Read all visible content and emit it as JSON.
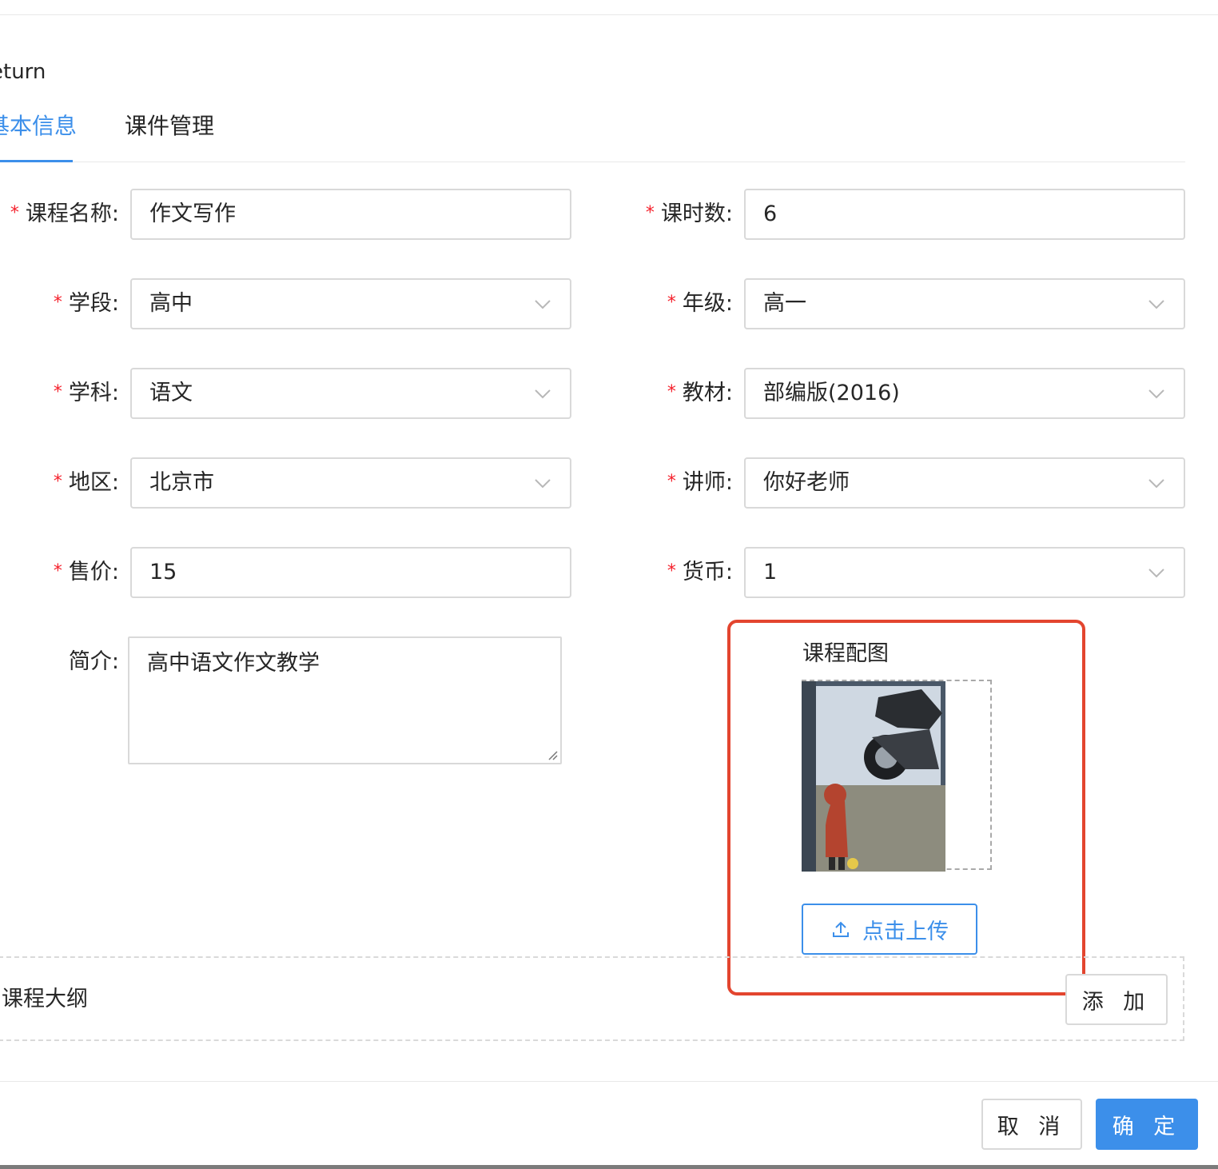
{
  "header": {
    "return_label": "eturn"
  },
  "tabs": [
    {
      "label": "基本信息",
      "active": true
    },
    {
      "label": "课件管理",
      "active": false
    }
  ],
  "required_mark": "*",
  "form": {
    "course_name": {
      "label": "课程名称:",
      "value": "作文写作"
    },
    "hours": {
      "label": "课时数:",
      "value": "6"
    },
    "stage": {
      "label": "学段:",
      "value": "高中"
    },
    "grade": {
      "label": "年级:",
      "value": "高一"
    },
    "subject": {
      "label": "学科:",
      "value": "语文"
    },
    "textbook": {
      "label": "教材:",
      "value": "部编版(2016)"
    },
    "region": {
      "label": "地区:",
      "value": "北京市"
    },
    "teacher": {
      "label": "讲师:",
      "value": "你好老师"
    },
    "price": {
      "label": "售价:",
      "value": "15"
    },
    "currency": {
      "label": "货币:",
      "value": "1"
    },
    "intro": {
      "label": "简介:",
      "value": "高中语文作文教学"
    }
  },
  "course_image": {
    "label": "课程配图",
    "upload_button": "点击上传",
    "upload_icon": "upload-icon",
    "thumbnail": "motorcycle-child-illustration"
  },
  "outline": {
    "title": "课程大纲",
    "add_button": "添 加"
  },
  "footer": {
    "cancel_button": "取 消",
    "ok_button": "确 定"
  },
  "colors": {
    "accent": "#3c8fea",
    "required": "#f5222d",
    "highlight_box": "#e3452f",
    "border": "#d9d9d9"
  }
}
